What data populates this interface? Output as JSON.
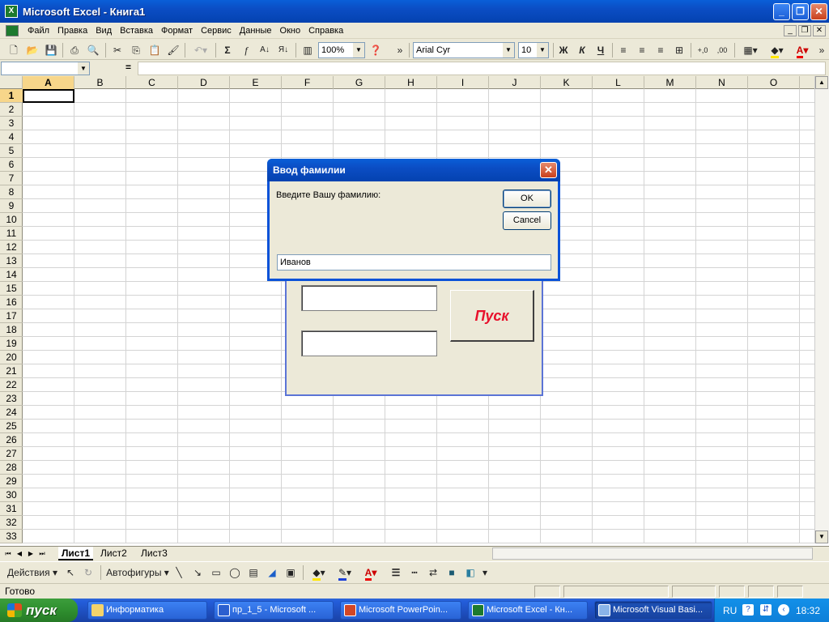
{
  "window": {
    "title": "Microsoft Excel - Книга1",
    "minimize": "_",
    "restore": "❐",
    "close": "✕"
  },
  "menu": [
    "Файл",
    "Правка",
    "Вид",
    "Вставка",
    "Формат",
    "Сервис",
    "Данные",
    "Окно",
    "Справка"
  ],
  "toolbar": {
    "zoom": "100%",
    "font": "Arial Cyr",
    "size": "10",
    "bold": "Ж",
    "italic": "К",
    "underline": "Ч",
    "autosum": "Σ",
    "fx": "f",
    "more": "»"
  },
  "formula": {
    "eq": "="
  },
  "columns": [
    "A",
    "B",
    "C",
    "D",
    "E",
    "F",
    "G",
    "H",
    "I",
    "J",
    "K",
    "L",
    "M",
    "N",
    "O"
  ],
  "row_count": 33,
  "sheets": [
    "Лист1",
    "Лист2",
    "Лист3"
  ],
  "draw": {
    "actions": "Действия",
    "autoshapes": "Автофигуры"
  },
  "status": {
    "text": "Готово"
  },
  "taskbar": {
    "start": "пуск",
    "items": [
      "Информатика",
      "пр_1_5 - Microsoft ...",
      "Microsoft PowerPoin...",
      "Microsoft Excel - Кн...",
      "Microsoft Visual Basi..."
    ],
    "lang": "RU",
    "time": "18:32"
  },
  "userform": {
    "button": "Пуск"
  },
  "dialog": {
    "title": "Ввод фамилии",
    "prompt": "Введите Вашу фамилию:",
    "ok": "OK",
    "cancel": "Cancel",
    "value": "Иванов"
  },
  "colors": {
    "xp_blue": "#0b4dc4",
    "taskbar": "#245edb",
    "start_green": "#3c9e3c",
    "button_red_text": "#e8102b"
  }
}
